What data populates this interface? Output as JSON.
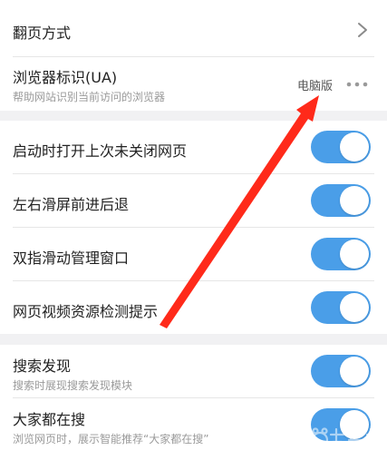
{
  "section1": {
    "page_turn": {
      "title": "翻页方式"
    },
    "ua": {
      "title": "浏览器标识(UA)",
      "subtitle": "帮助网站识别当前访问的浏览器",
      "value": "电脑版"
    }
  },
  "section2": {
    "items": [
      {
        "title": "启动时打开上次未关闭网页",
        "toggle_on": true
      },
      {
        "title": "左右滑屏前进后退",
        "toggle_on": true
      },
      {
        "title": "双指滑动管理窗口",
        "toggle_on": true
      },
      {
        "title": "网页视频资源检测提示",
        "toggle_on": true
      }
    ]
  },
  "section3": {
    "search_discovery": {
      "title": "搜索发现",
      "subtitle": "搜索时展现搜索发现模块",
      "toggle_on": true
    },
    "everyone_searching": {
      "title": "大家都在搜",
      "subtitle": "浏览网页时，展示智能推荐“大家都在搜”",
      "toggle_on": true
    }
  },
  "colors": {
    "toggle_on": "#4a9ee8",
    "annotation_arrow": "#ff2a1a",
    "background": "#f1f1f3"
  },
  "icons": {
    "chevron": "chevron-right-icon",
    "more": "more-dots-icon",
    "arrow": "annotation-arrow",
    "watermark": "baidu-jingyan-watermark"
  }
}
